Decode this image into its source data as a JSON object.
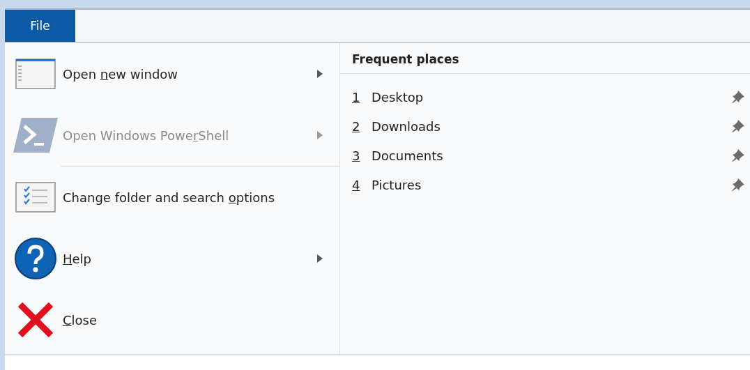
{
  "tab": {
    "label": "File",
    "selected": true
  },
  "menu_items": [
    {
      "kind": "window",
      "label_before": "Open ",
      "access_key": "n",
      "label_after": "ew window",
      "disabled": false,
      "has_submenu": true
    },
    {
      "kind": "powershell",
      "label_before": "Open Windows Powe",
      "access_key": "r",
      "label_after": "Shell",
      "disabled": true,
      "has_submenu": true
    },
    {
      "kind": "separator"
    },
    {
      "kind": "options",
      "label_before": "Change folder and search ",
      "access_key": "o",
      "label_after": "ptions",
      "disabled": false,
      "has_submenu": false
    },
    {
      "kind": "help",
      "access_key": "H",
      "label_after": "elp",
      "disabled": false,
      "has_submenu": true
    },
    {
      "kind": "close",
      "access_key": "C",
      "label_after": "lose",
      "disabled": false,
      "has_submenu": false
    }
  ],
  "frequent_places": {
    "title": "Frequent places",
    "items": [
      {
        "number": "1",
        "label": "Desktop",
        "pinned": true
      },
      {
        "number": "2",
        "label": "Downloads",
        "pinned": true
      },
      {
        "number": "3",
        "label": "Documents",
        "pinned": true
      },
      {
        "number": "4",
        "label": "Pictures",
        "pinned": true
      }
    ]
  }
}
